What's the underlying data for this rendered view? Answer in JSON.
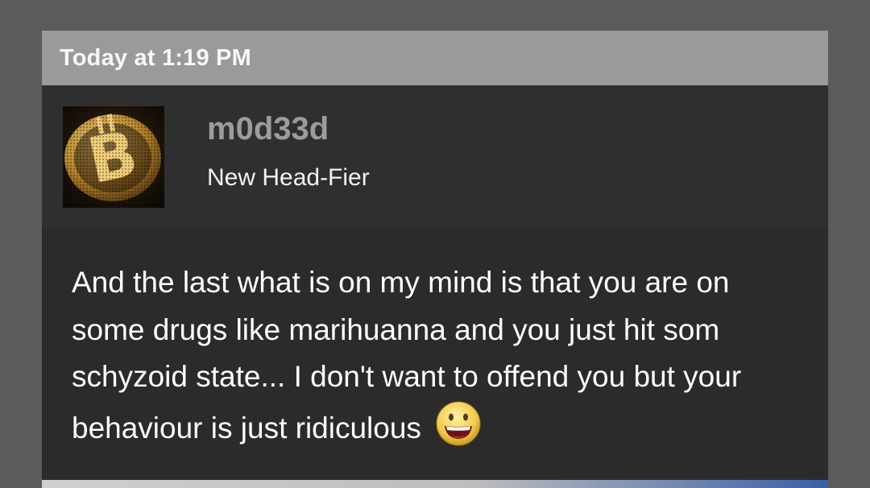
{
  "post": {
    "timestamp": "Today at 1:19 PM",
    "author": {
      "username": "m0d33d",
      "title": "New Head-Fier",
      "avatar_icon": "bitcoin-icon"
    },
    "message": {
      "text": "And the last what is on my mind is that you are on some drugs like marihuanna and you just hit som schyzoid state... I don't want to offend you but your behaviour is just ridiculous",
      "emoji_icon": "grinning-face-icon"
    }
  },
  "colors": {
    "page_background": "#5b5b5b",
    "timestamp_bar": "#9a9a9a",
    "author_background": "#2f2f2f",
    "message_background": "#2b2b2b",
    "username": "#9c9c9c",
    "text": "#ffffff"
  }
}
